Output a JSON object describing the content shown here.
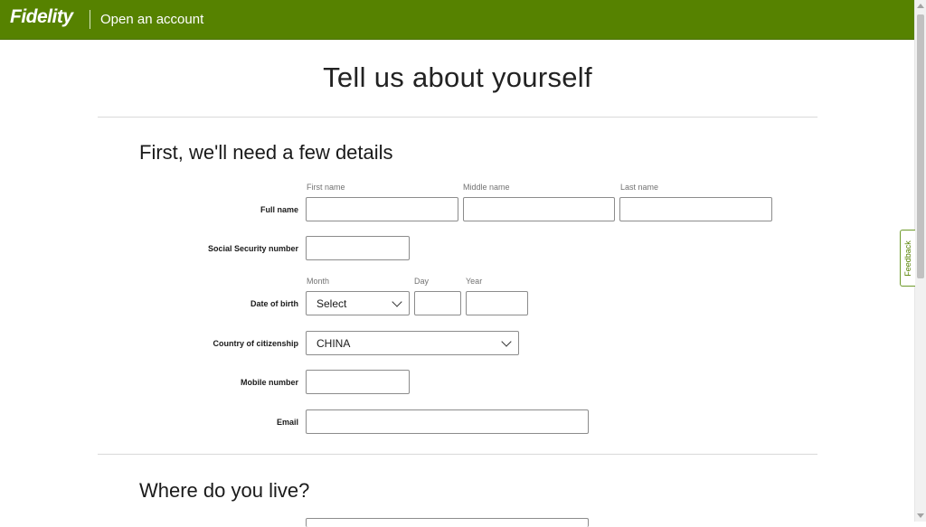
{
  "header": {
    "logo_text": "Fidelity",
    "title": "Open an account",
    "brand_color": "#568200"
  },
  "page": {
    "title": "Tell us about yourself"
  },
  "section1": {
    "heading": "First, we'll need a few details",
    "full_name": {
      "label": "Full name",
      "first_label": "First name",
      "middle_label": "Middle name",
      "last_label": "Last name",
      "first_value": "",
      "middle_value": "",
      "last_value": ""
    },
    "ssn": {
      "label": "Social Security number",
      "value": ""
    },
    "dob": {
      "label": "Date of birth",
      "month_label": "Month",
      "day_label": "Day",
      "year_label": "Year",
      "month_value": "Select",
      "day_value": "",
      "year_value": ""
    },
    "citizenship": {
      "label": "Country of citizenship",
      "value": "CHINA"
    },
    "mobile": {
      "label": "Mobile number",
      "value": ""
    },
    "email": {
      "label": "Email",
      "value": ""
    }
  },
  "section2": {
    "heading": "Where do you live?"
  },
  "feedback": {
    "label": "Feedback"
  }
}
